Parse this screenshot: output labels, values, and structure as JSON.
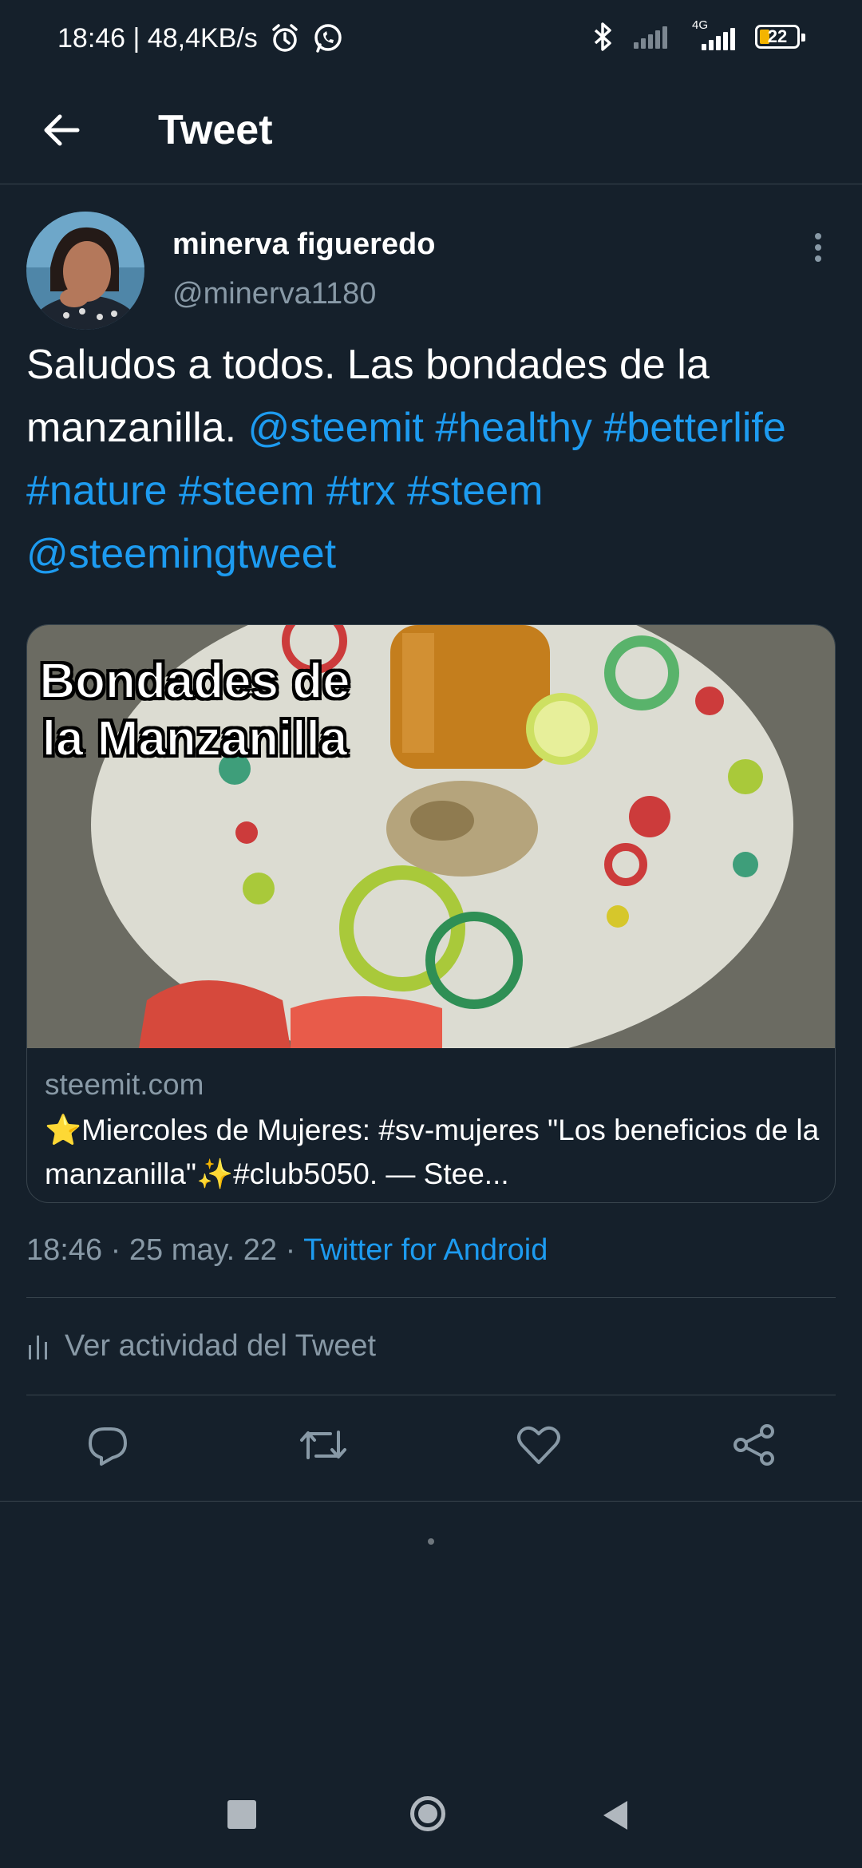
{
  "status_bar": {
    "time_speed": "18:46 | 48,4KB/s",
    "network": "4G",
    "battery": "22"
  },
  "header": {
    "title": "Tweet"
  },
  "tweet": {
    "author_name": "minerva figueredo",
    "author_handle": "@minerva1180",
    "text_plain": "Saludos a todos. Las bondades de la manzanilla.",
    "mention_1": "@steemit",
    "tag_healthy": "#healthy",
    "tag_betterlife": "#betterlife",
    "tag_nature": "#nature",
    "tag_steem_1": "#steem",
    "tag_trx": "#trx",
    "tag_steem_2": "#steem",
    "mention_2": "@steemingtweet",
    "card": {
      "image_overlay_text": "Bondades de la Manzanilla",
      "domain": "steemit.com",
      "title": "⭐Miercoles de Mujeres: #sv-mujeres \"Los beneficios de la manzanilla\"✨#club5050. — Stee..."
    },
    "timestamp": "18:46 · 25 may. 22 · ",
    "source": "Twitter for Android",
    "activity_label": "Ver actividad del Tweet"
  },
  "colors": {
    "background": "#15202b",
    "accent": "#1d9bf0",
    "secondary_text": "#8899a6",
    "divider": "#38444d"
  }
}
